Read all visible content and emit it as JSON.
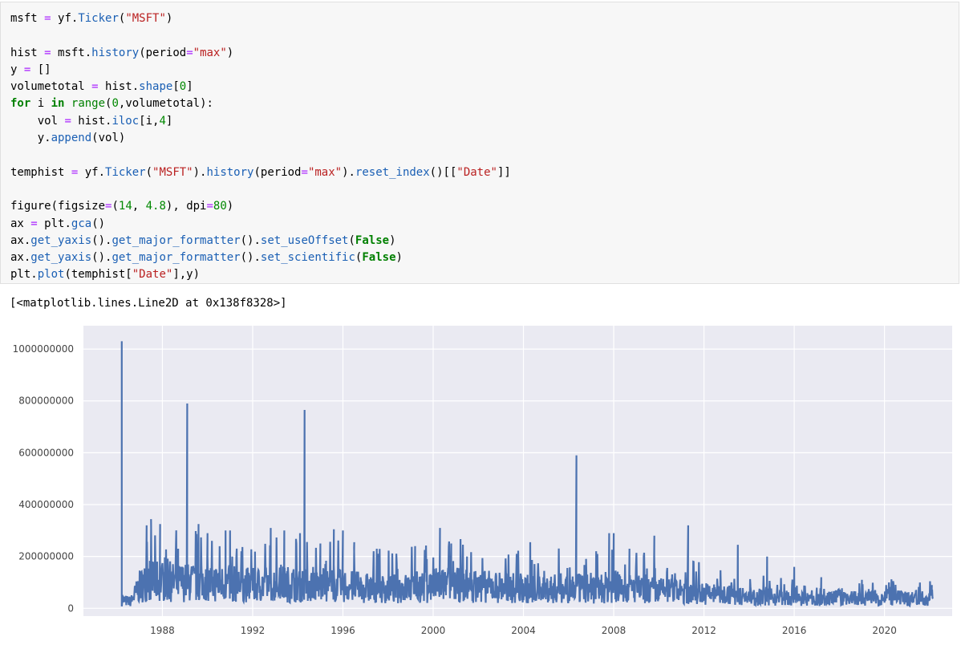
{
  "cell": {
    "code_lines": [
      [
        {
          "t": "msft ",
          "c": ""
        },
        {
          "t": "=",
          "c": "op"
        },
        {
          "t": " yf.",
          "c": ""
        },
        {
          "t": "Ticker",
          "c": "attr"
        },
        {
          "t": "(",
          "c": ""
        },
        {
          "t": "\"MSFT\"",
          "c": "str"
        },
        {
          "t": ")",
          "c": ""
        }
      ],
      [],
      [
        {
          "t": "hist ",
          "c": ""
        },
        {
          "t": "=",
          "c": "op"
        },
        {
          "t": " msft.",
          "c": ""
        },
        {
          "t": "history",
          "c": "attr"
        },
        {
          "t": "(period",
          "c": ""
        },
        {
          "t": "=",
          "c": "op"
        },
        {
          "t": "\"max\"",
          "c": "str"
        },
        {
          "t": ")",
          "c": ""
        }
      ],
      [
        {
          "t": "y ",
          "c": ""
        },
        {
          "t": "=",
          "c": "op"
        },
        {
          "t": " []",
          "c": ""
        }
      ],
      [
        {
          "t": "volumetotal ",
          "c": ""
        },
        {
          "t": "=",
          "c": "op"
        },
        {
          "t": " hist.",
          "c": ""
        },
        {
          "t": "shape",
          "c": "attr"
        },
        {
          "t": "[",
          "c": ""
        },
        {
          "t": "0",
          "c": "num"
        },
        {
          "t": "]",
          "c": ""
        }
      ],
      [
        {
          "t": "for",
          "c": "kw"
        },
        {
          "t": " i ",
          "c": ""
        },
        {
          "t": "in",
          "c": "kw"
        },
        {
          "t": " ",
          "c": ""
        },
        {
          "t": "range",
          "c": "bi"
        },
        {
          "t": "(",
          "c": ""
        },
        {
          "t": "0",
          "c": "num"
        },
        {
          "t": ",volumetotal):",
          "c": ""
        }
      ],
      [
        {
          "t": "    vol ",
          "c": ""
        },
        {
          "t": "=",
          "c": "op"
        },
        {
          "t": " hist.",
          "c": ""
        },
        {
          "t": "iloc",
          "c": "attr"
        },
        {
          "t": "[i,",
          "c": ""
        },
        {
          "t": "4",
          "c": "num"
        },
        {
          "t": "]",
          "c": ""
        }
      ],
      [
        {
          "t": "    y.",
          "c": ""
        },
        {
          "t": "append",
          "c": "attr"
        },
        {
          "t": "(vol)",
          "c": ""
        }
      ],
      [],
      [
        {
          "t": "temphist ",
          "c": ""
        },
        {
          "t": "=",
          "c": "op"
        },
        {
          "t": " yf.",
          "c": ""
        },
        {
          "t": "Ticker",
          "c": "attr"
        },
        {
          "t": "(",
          "c": ""
        },
        {
          "t": "\"MSFT\"",
          "c": "str"
        },
        {
          "t": ").",
          "c": ""
        },
        {
          "t": "history",
          "c": "attr"
        },
        {
          "t": "(period",
          "c": ""
        },
        {
          "t": "=",
          "c": "op"
        },
        {
          "t": "\"max\"",
          "c": "str"
        },
        {
          "t": ").",
          "c": ""
        },
        {
          "t": "reset_index",
          "c": "attr"
        },
        {
          "t": "()[[",
          "c": ""
        },
        {
          "t": "\"Date\"",
          "c": "str"
        },
        {
          "t": "]]",
          "c": ""
        }
      ],
      [],
      [
        {
          "t": "figure(figsize",
          "c": ""
        },
        {
          "t": "=",
          "c": "op"
        },
        {
          "t": "(",
          "c": ""
        },
        {
          "t": "14",
          "c": "num"
        },
        {
          "t": ", ",
          "c": ""
        },
        {
          "t": "4.8",
          "c": "num"
        },
        {
          "t": "), dpi",
          "c": ""
        },
        {
          "t": "=",
          "c": "op"
        },
        {
          "t": "80",
          "c": "num"
        },
        {
          "t": ")",
          "c": ""
        }
      ],
      [
        {
          "t": "ax ",
          "c": ""
        },
        {
          "t": "=",
          "c": "op"
        },
        {
          "t": " plt.",
          "c": ""
        },
        {
          "t": "gca",
          "c": "attr"
        },
        {
          "t": "()",
          "c": ""
        }
      ],
      [
        {
          "t": "ax.",
          "c": ""
        },
        {
          "t": "get_yaxis",
          "c": "attr"
        },
        {
          "t": "().",
          "c": ""
        },
        {
          "t": "get_major_formatter",
          "c": "attr"
        },
        {
          "t": "().",
          "c": ""
        },
        {
          "t": "set_useOffset",
          "c": "attr"
        },
        {
          "t": "(",
          "c": ""
        },
        {
          "t": "False",
          "c": "kw"
        },
        {
          "t": ")",
          "c": ""
        }
      ],
      [
        {
          "t": "ax.",
          "c": ""
        },
        {
          "t": "get_yaxis",
          "c": "attr"
        },
        {
          "t": "().",
          "c": ""
        },
        {
          "t": "get_major_formatter",
          "c": "attr"
        },
        {
          "t": "().",
          "c": ""
        },
        {
          "t": "set_scientific",
          "c": "attr"
        },
        {
          "t": "(",
          "c": ""
        },
        {
          "t": "False",
          "c": "kw"
        },
        {
          "t": ")",
          "c": ""
        }
      ],
      [
        {
          "t": "plt.",
          "c": ""
        },
        {
          "t": "plot",
          "c": "attr"
        },
        {
          "t": "(temphist[",
          "c": ""
        },
        {
          "t": "\"Date\"",
          "c": "str"
        },
        {
          "t": "],y)",
          "c": ""
        }
      ]
    ]
  },
  "output": {
    "repr": "[<matplotlib.lines.Line2D at 0x138f8328>]"
  },
  "colors": {
    "plot_bg": "#eaeaf2",
    "grid": "#ffffff",
    "line": "#4c72b0"
  },
  "chart_data": {
    "type": "line",
    "title": "",
    "xlabel": "",
    "ylabel": "",
    "grid": true,
    "xlim": [
      1984.5,
      2023.0
    ],
    "ylim": [
      -30000000,
      1090000000
    ],
    "xticks": [
      1988,
      1992,
      1996,
      2000,
      2004,
      2008,
      2012,
      2016,
      2020
    ],
    "xtick_labels": [
      "1988",
      "1992",
      "1996",
      "2000",
      "2004",
      "2008",
      "2012",
      "2016",
      "2020"
    ],
    "yticks": [
      0,
      200000000,
      400000000,
      600000000,
      800000000,
      1000000000
    ],
    "ytick_labels": [
      "0",
      "200000000",
      "400000000",
      "600000000",
      "800000000",
      "1000000000"
    ],
    "base": [
      [
        1986.2,
        30000000
      ],
      [
        1986.6,
        25000000
      ],
      [
        1987.0,
        80000000
      ],
      [
        1987.5,
        110000000
      ],
      [
        1988.0,
        95000000
      ],
      [
        1989.0,
        95000000
      ],
      [
        1990.0,
        95000000
      ],
      [
        1991.0,
        90000000
      ],
      [
        1992.0,
        85000000
      ],
      [
        1993.0,
        90000000
      ],
      [
        1994.0,
        88000000
      ],
      [
        1995.0,
        85000000
      ],
      [
        1996.0,
        82000000
      ],
      [
        1997.0,
        75000000
      ],
      [
        1998.0,
        70000000
      ],
      [
        1999.0,
        75000000
      ],
      [
        2000.0,
        85000000
      ],
      [
        2001.0,
        85000000
      ],
      [
        2002.0,
        80000000
      ],
      [
        2003.0,
        78000000
      ],
      [
        2004.0,
        72000000
      ],
      [
        2005.0,
        70000000
      ],
      [
        2006.0,
        75000000
      ],
      [
        2007.0,
        70000000
      ],
      [
        2008.0,
        80000000
      ],
      [
        2009.0,
        70000000
      ],
      [
        2010.0,
        65000000
      ],
      [
        2011.0,
        60000000
      ],
      [
        2012.0,
        55000000
      ],
      [
        2013.0,
        50000000
      ],
      [
        2014.0,
        40000000
      ],
      [
        2015.0,
        42000000
      ],
      [
        2016.0,
        35000000
      ],
      [
        2017.0,
        30000000
      ],
      [
        2018.0,
        40000000
      ],
      [
        2019.0,
        35000000
      ],
      [
        2020.0,
        40000000
      ],
      [
        2021.0,
        35000000
      ],
      [
        2022.15,
        40000000
      ]
    ],
    "spikes": [
      [
        1986.2,
        1030000000
      ],
      [
        1987.3,
        320000000
      ],
      [
        1987.5,
        310000000
      ],
      [
        1987.9,
        325000000
      ],
      [
        1988.7,
        230000000
      ],
      [
        1989.1,
        790000000
      ],
      [
        1989.6,
        325000000
      ],
      [
        1990.0,
        290000000
      ],
      [
        1990.8,
        300000000
      ],
      [
        1991.0,
        300000000
      ],
      [
        1991.5,
        220000000
      ],
      [
        1992.8,
        310000000
      ],
      [
        1993.4,
        300000000
      ],
      [
        1994.1,
        290000000
      ],
      [
        1994.3,
        765000000
      ],
      [
        1995.0,
        250000000
      ],
      [
        1995.6,
        305000000
      ],
      [
        1996.0,
        300000000
      ],
      [
        1996.5,
        255000000
      ],
      [
        1997.5,
        230000000
      ],
      [
        1999.2,
        240000000
      ],
      [
        2000.3,
        310000000
      ],
      [
        2000.8,
        250000000
      ],
      [
        2001.5,
        200000000
      ],
      [
        2003.7,
        210000000
      ],
      [
        2004.3,
        255000000
      ],
      [
        2006.35,
        590000000
      ],
      [
        2007.8,
        290000000
      ],
      [
        2008.0,
        290000000
      ],
      [
        2008.7,
        230000000
      ],
      [
        2009.8,
        280000000
      ],
      [
        2011.3,
        320000000
      ],
      [
        2013.5,
        245000000
      ],
      [
        2014.8,
        200000000
      ],
      [
        2016.0,
        160000000
      ],
      [
        2017.2,
        120000000
      ],
      [
        2019.0,
        110000000
      ],
      [
        2020.2,
        100000000
      ],
      [
        2022.1,
        90000000
      ]
    ]
  }
}
